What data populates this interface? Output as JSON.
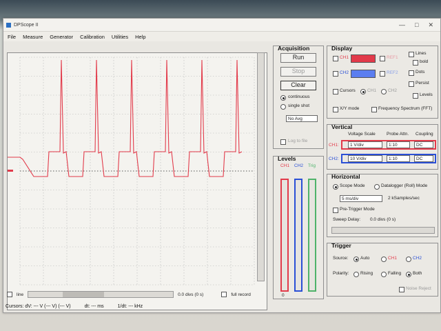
{
  "window": {
    "title": "DPScope II",
    "minimize": "—",
    "maximize": "□",
    "close": "✕"
  },
  "menu": [
    "File",
    "Measure",
    "Generator",
    "Calibration",
    "Utilities",
    "Help"
  ],
  "colors": {
    "ch1": "#e23a4a",
    "ch2": "#2a4fd6",
    "trig": "#4fb36a",
    "grid": "#b5b5b5"
  },
  "scope": {
    "line_label": "line",
    "divs": "0.0 divs (0 s)",
    "full_record": "full record"
  },
  "cursors": {
    "dv": "Cursors: dV: --- V   (--- V) (--- V)",
    "dt": "dt: --- ms",
    "inv_dt": "1/dt: --- kHz"
  },
  "acquisition": {
    "title": "Acquisition",
    "run": "Run",
    "stop": "Stop",
    "clear": "Clear",
    "continuous": "continuous",
    "single_shot": "single shot",
    "avg": "No Avg",
    "log": "Log to file"
  },
  "levels": {
    "title": "Levels",
    "ch1": "CH1",
    "ch2": "CH2",
    "trig": "Trig",
    "bottom": "0"
  },
  "display": {
    "title": "Display",
    "ch1": "CH1",
    "ch2": "CH2",
    "ref1": "REF1",
    "ref2": "REF2",
    "lines": "Lines",
    "bold": "bold",
    "dots": "Dots",
    "persist": "Persist",
    "levels": "Levels",
    "cursors": "Cursors",
    "cur_ch1": "CH1",
    "cur_ch2": "CH2",
    "xy": "X/Y mode",
    "fft": "Frequency Spectrum (FFT)"
  },
  "vertical": {
    "title": "Vertical",
    "h_scale": "Voltage Scale",
    "h_probe": "Probe Attn.",
    "h_coupling": "Coupling",
    "ch1": {
      "label": "CH1:",
      "scale": "1 V/div",
      "probe": "1:10",
      "coupling": "DC"
    },
    "ch2": {
      "label": "CH2:",
      "scale": "10 V/div",
      "probe": "1:10",
      "coupling": "DC"
    }
  },
  "horizontal": {
    "title": "Horizontal",
    "scope_mode": "Scope Mode",
    "datalogger": "Datalogger (Roll) Mode",
    "timebase": "5 ms/div",
    "rate": "2 kSamples/sec",
    "pretrigger": "Pre-Trigger Mode",
    "sweep_delay": "Sweep Delay:",
    "sweep_val": "0.0 divs (0 s)"
  },
  "trigger": {
    "title": "Trigger",
    "source": "Source:",
    "auto": "Auto",
    "ch1": "CH1",
    "ch2": "CH2",
    "polarity": "Polarity:",
    "rising": "Rising",
    "falling": "Falling",
    "both": "Both",
    "noise": "Noise Reject"
  }
}
